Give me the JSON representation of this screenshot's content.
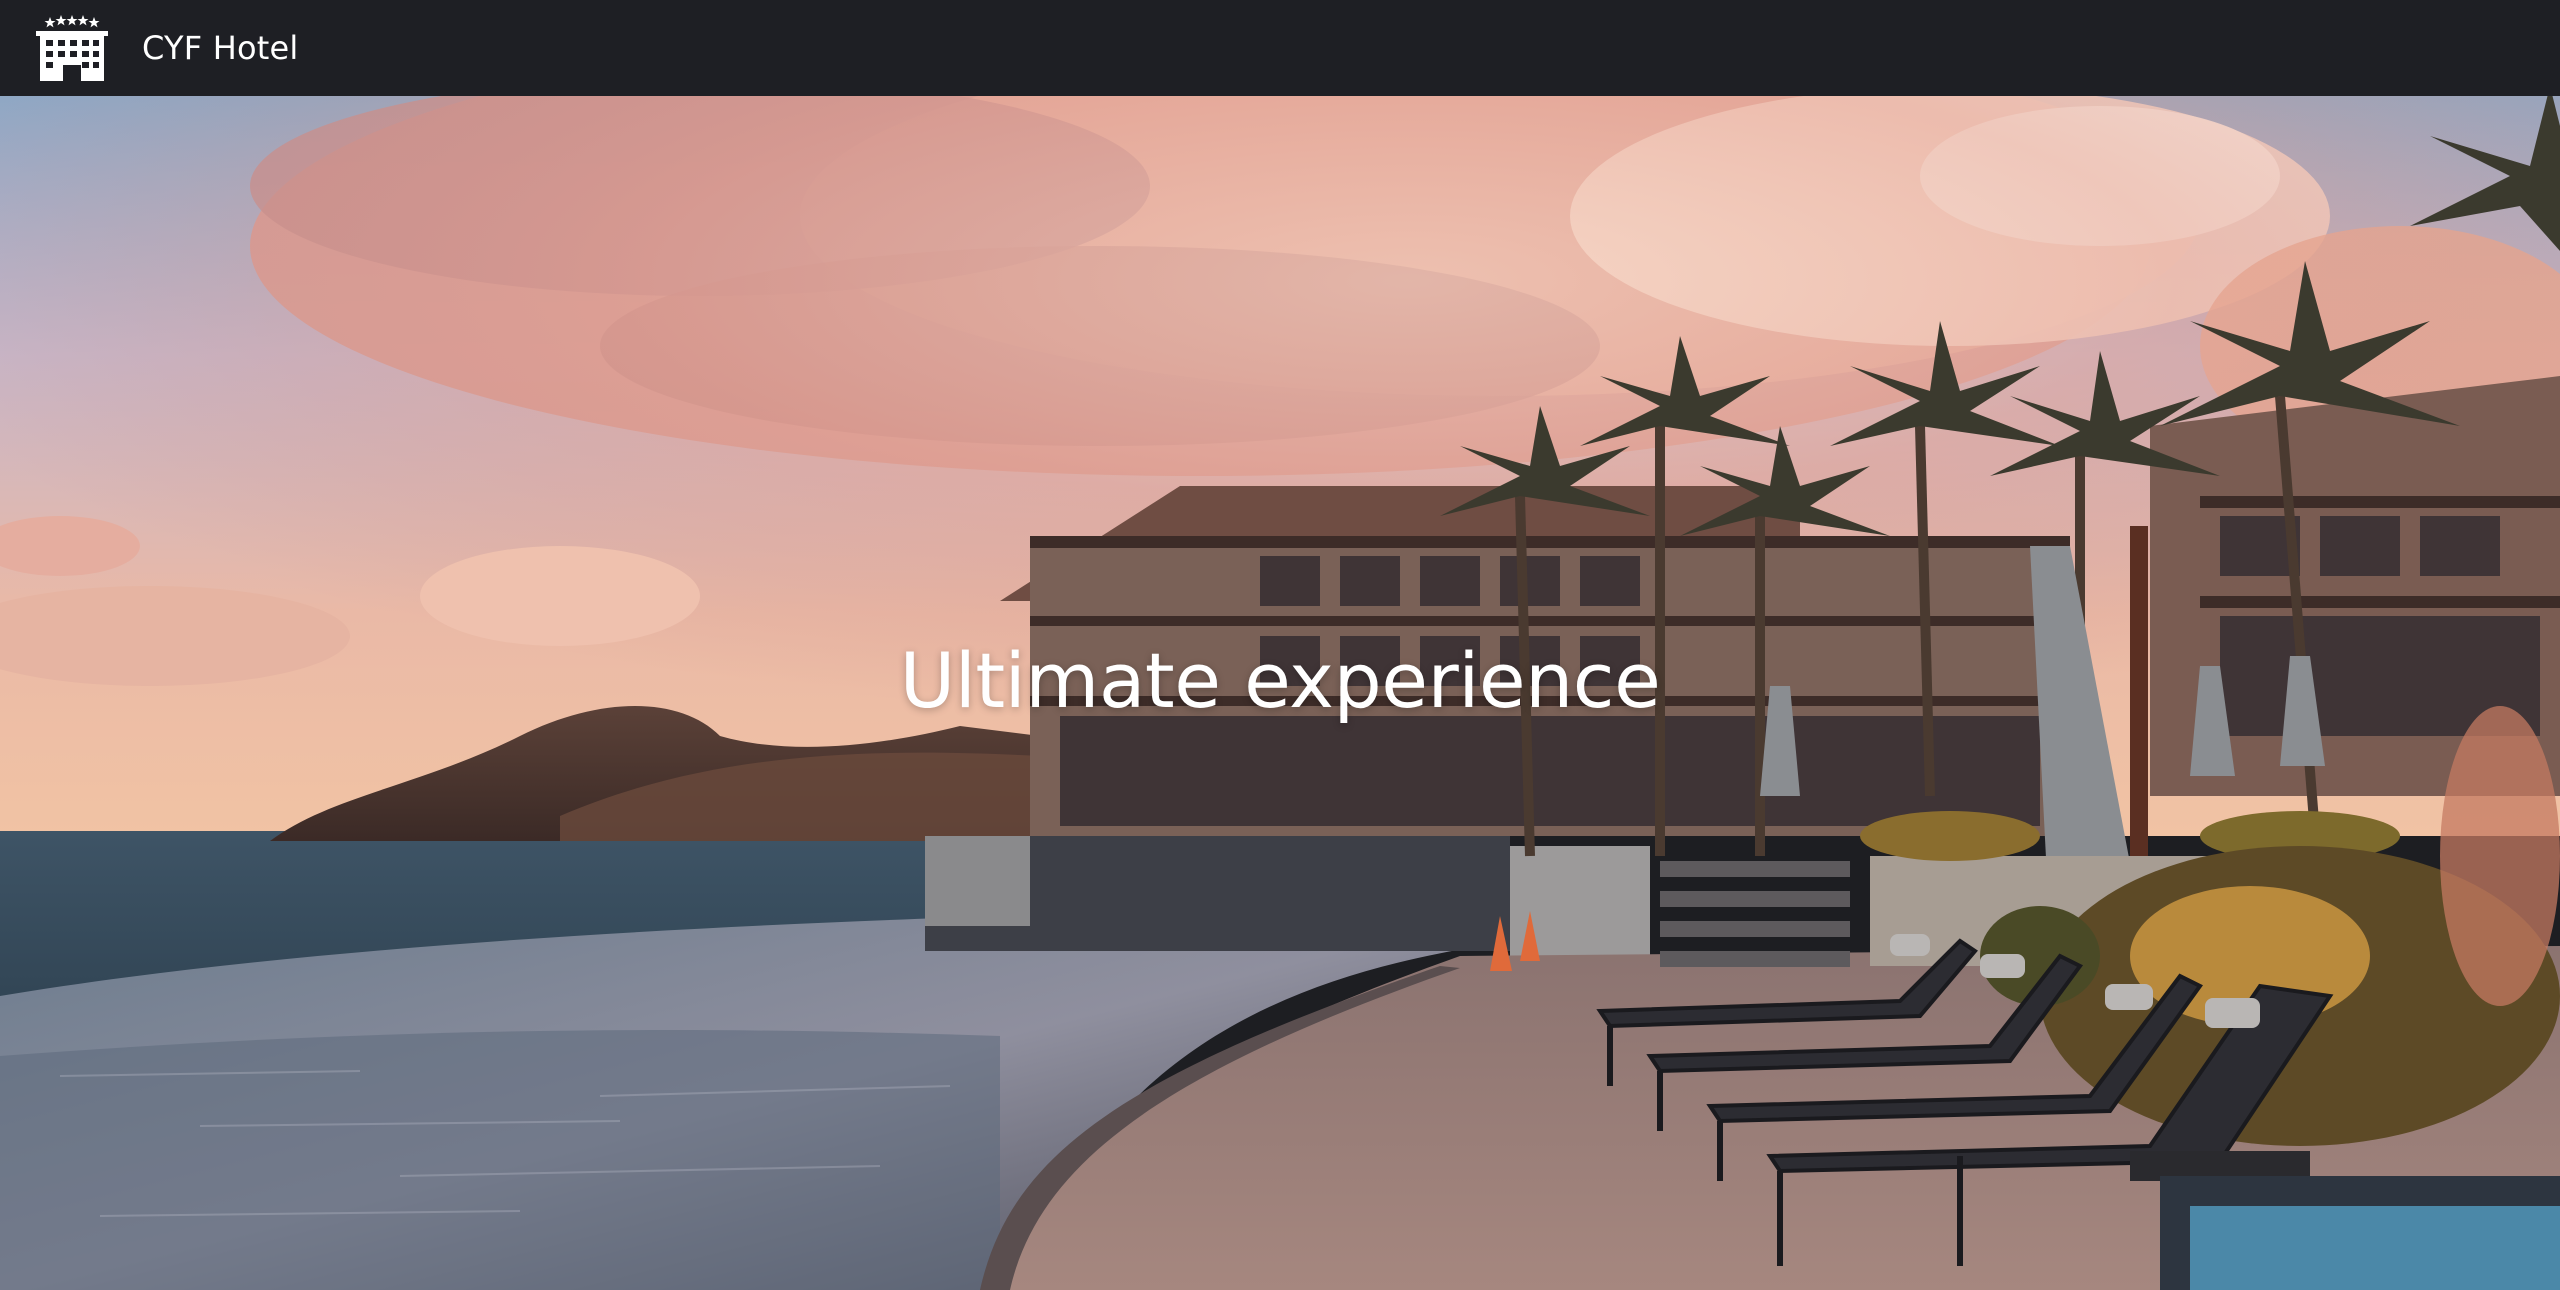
{
  "navbar": {
    "brand_name": "CYF Hotel",
    "logo_icon": "hotel-building-icon",
    "background": "#1e1f24"
  },
  "hero": {
    "title": "Ultimate experience",
    "image_description_icon": "resort-pool-photo"
  }
}
